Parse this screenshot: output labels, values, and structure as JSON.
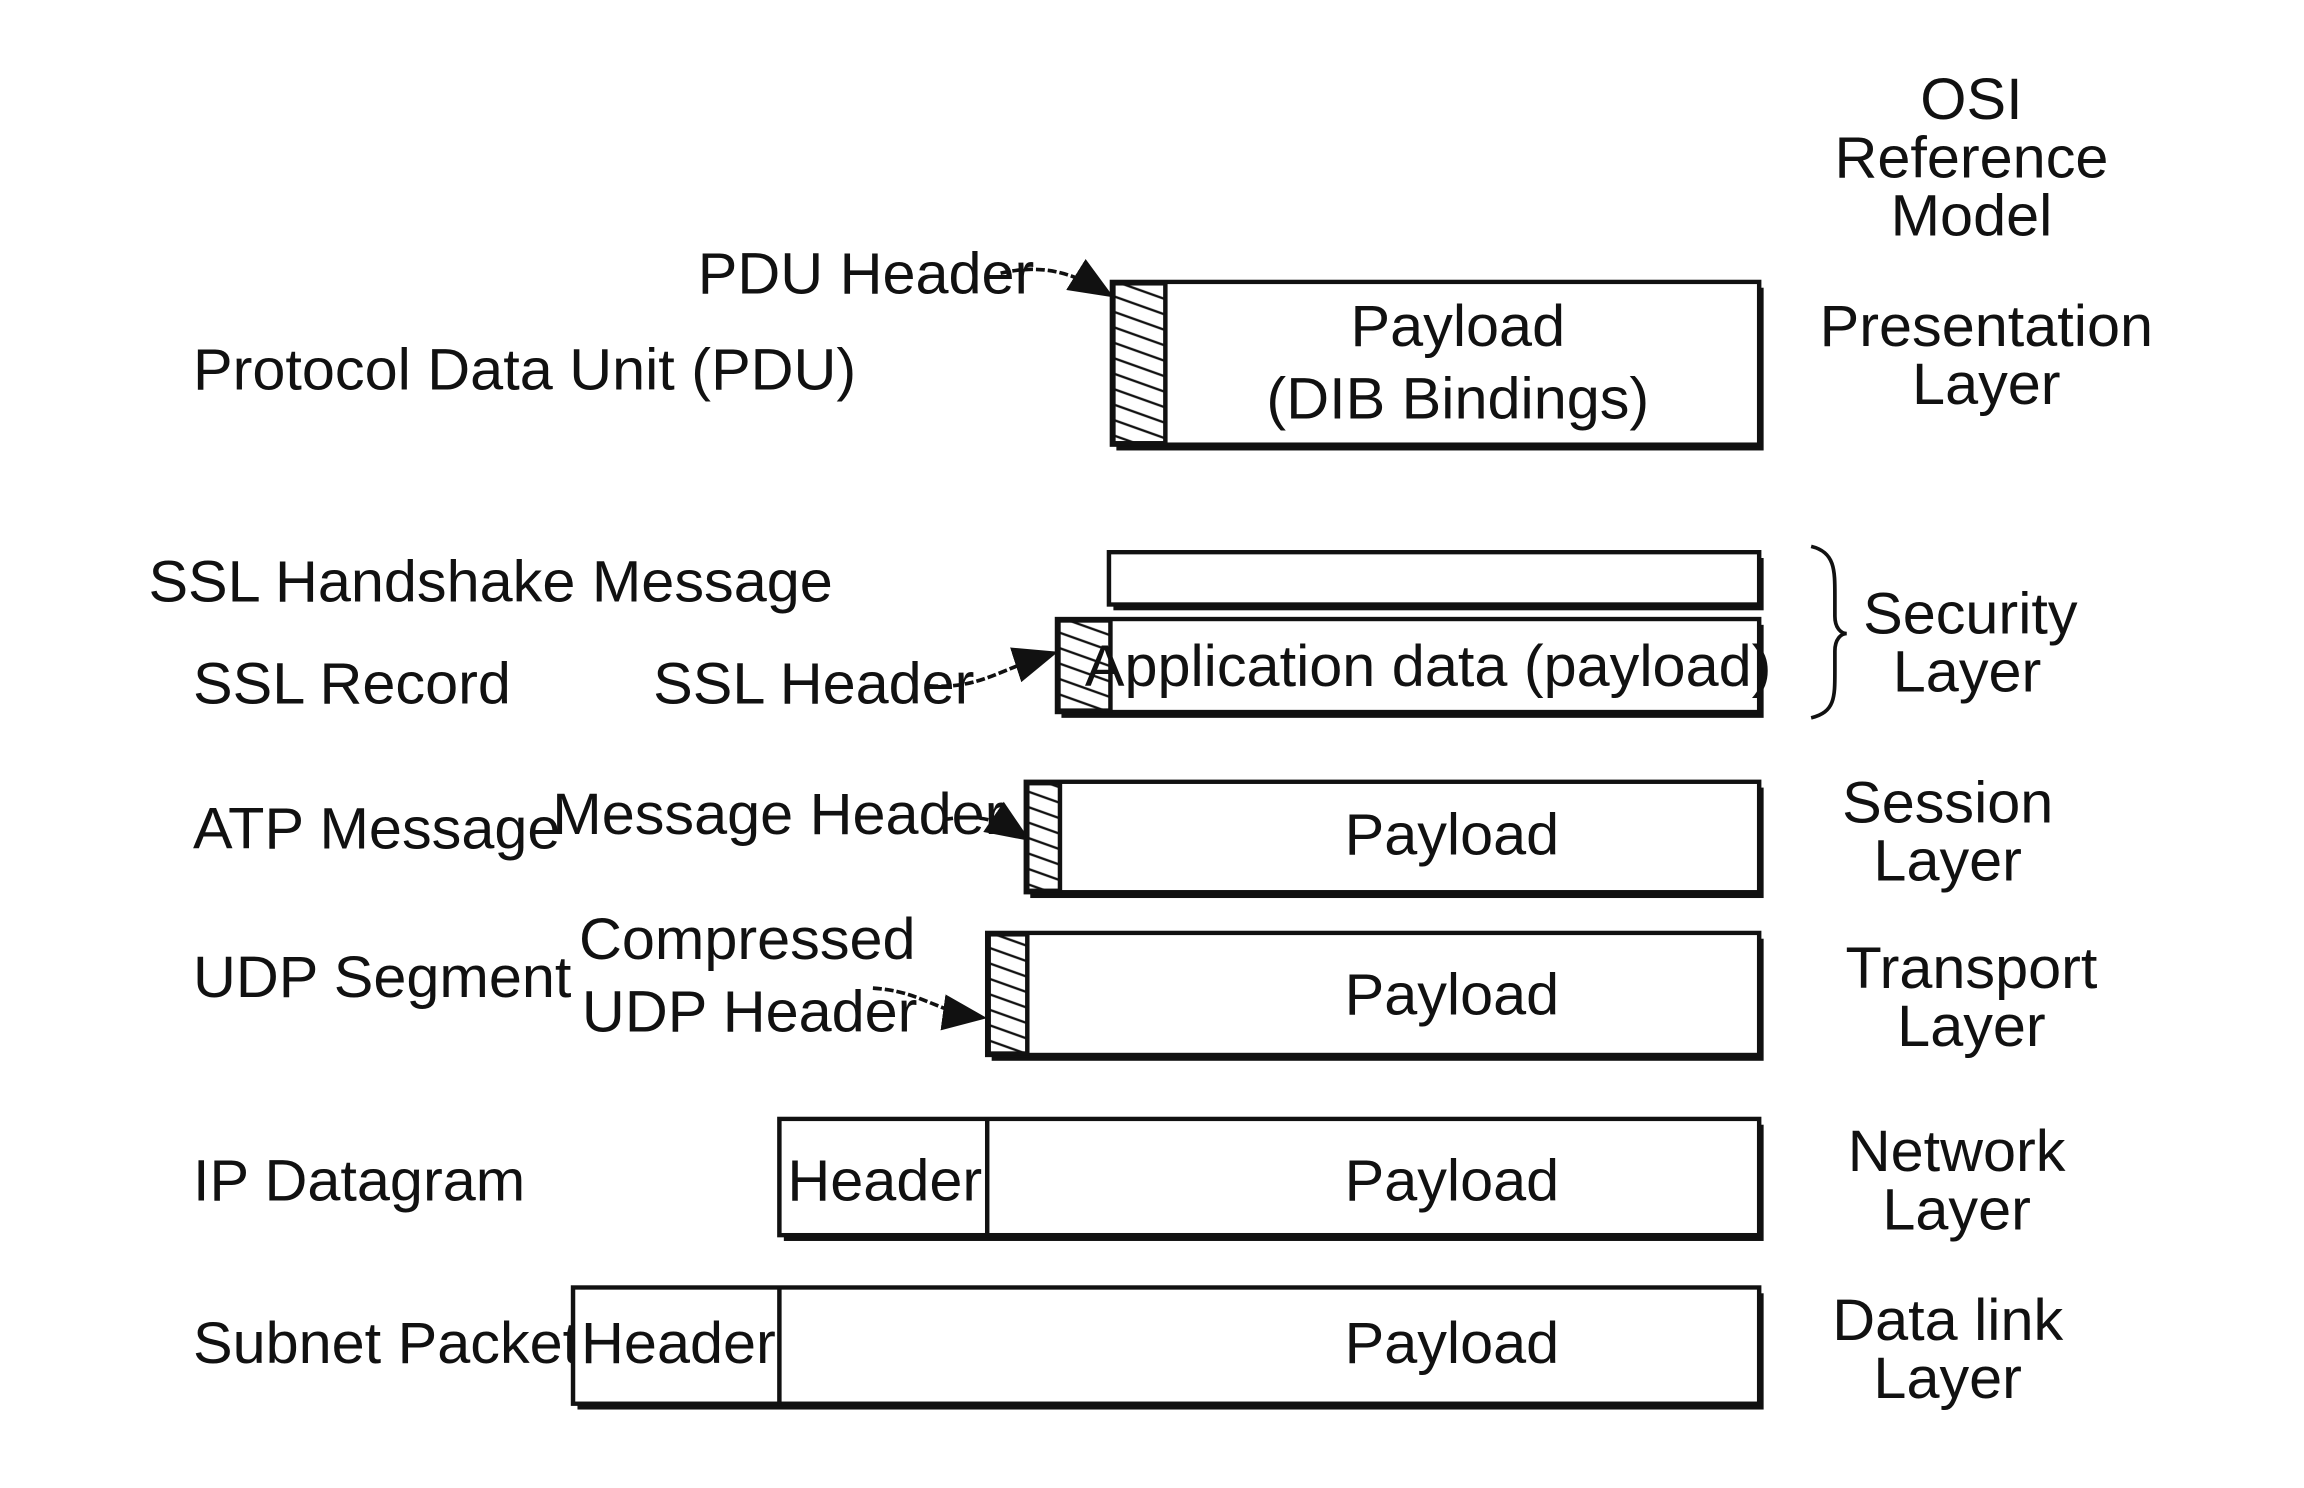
{
  "title": {
    "lines": [
      "OSI",
      "Reference",
      "Model"
    ]
  },
  "rows": [
    {
      "unit": "Protocol Data Unit (PDU)",
      "header_label": "PDU Header",
      "payload_lines": [
        "Payload",
        "(DIB Bindings)"
      ],
      "layer_lines": [
        "Presentation",
        "Layer"
      ]
    },
    {
      "unit": "SSL Handshake Message"
    },
    {
      "unit": "SSL Record",
      "header_label": "SSL Header",
      "payload_lines": [
        "Application data (payload)"
      ]
    },
    {
      "unit": "ATP Message",
      "header_label": "Message Header",
      "payload_lines": [
        "Payload"
      ],
      "layer_lines": [
        "Session",
        "Layer"
      ]
    },
    {
      "unit": "UDP Segment",
      "header_label_lines": [
        "Compressed",
        "UDP Header"
      ],
      "payload_lines": [
        "Payload"
      ],
      "layer_lines": [
        "Transport",
        "Layer"
      ]
    },
    {
      "unit": "IP Datagram",
      "header_text": "Header",
      "payload_lines": [
        "Payload"
      ],
      "layer_lines": [
        "Network",
        "Layer"
      ]
    },
    {
      "unit": "Subnet Packet",
      "header_text": "Header",
      "payload_lines": [
        "Payload"
      ],
      "layer_lines": [
        "Data link",
        "Layer"
      ]
    }
  ],
  "security_layer_lines": [
    "Security",
    "Layer"
  ]
}
